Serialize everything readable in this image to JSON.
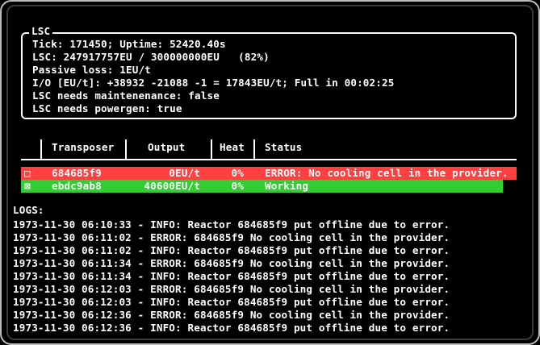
{
  "lsc": {
    "title": "LSC",
    "lines": [
      "Tick: 171450; Uptime: 52420.40s",
      "LSC: 247917757EU / 300000000EU   (82%)",
      "Passive loss: 1EU/t",
      "I/O [EU/t]: +38932 -21088 -1 = 17843EU/t; Full in 00:02:25",
      "LSC needs maintenenance: false",
      "LSC needs powergen: true"
    ]
  },
  "table": {
    "headers": {
      "transposer": "Transposer",
      "output": "Output",
      "heat": "Heat",
      "status": "Status"
    },
    "rows": [
      {
        "checkbox": "□",
        "transposer": "684685f9",
        "output": "0EU/t",
        "heat": "0%",
        "status": "ERROR: No cooling cell in the provider.",
        "color": "#ff4040"
      },
      {
        "checkbox": "⊠",
        "transposer": "ebdc9ab8",
        "output": "40600EU/t",
        "heat": "0%",
        "status": "Working",
        "color": "#33cc33"
      }
    ]
  },
  "logs": {
    "title": "LOGS:",
    "lines": [
      "1973-11-30 06:10:33 - INFO: Reactor 684685f9 put offline due to error.",
      "1973-11-30 06:11:02 - ERROR: 684685f9 No cooling cell in the provider.",
      "1973-11-30 06:11:02 - INFO: Reactor 684685f9 put offline due to error.",
      "1973-11-30 06:11:34 - ERROR: 684685f9 No cooling cell in the provider.",
      "1973-11-30 06:11:34 - INFO: Reactor 684685f9 put offline due to error.",
      "1973-11-30 06:12:03 - ERROR: 684685f9 No cooling cell in the provider.",
      "1973-11-30 06:12:03 - INFO: Reactor 684685f9 put offline due to error.",
      "1973-11-30 06:12:36 - ERROR: 684685f9 No cooling cell in the provider.",
      "1973-11-30 06:12:36 - INFO: Reactor 684685f9 put offline due to error."
    ]
  }
}
